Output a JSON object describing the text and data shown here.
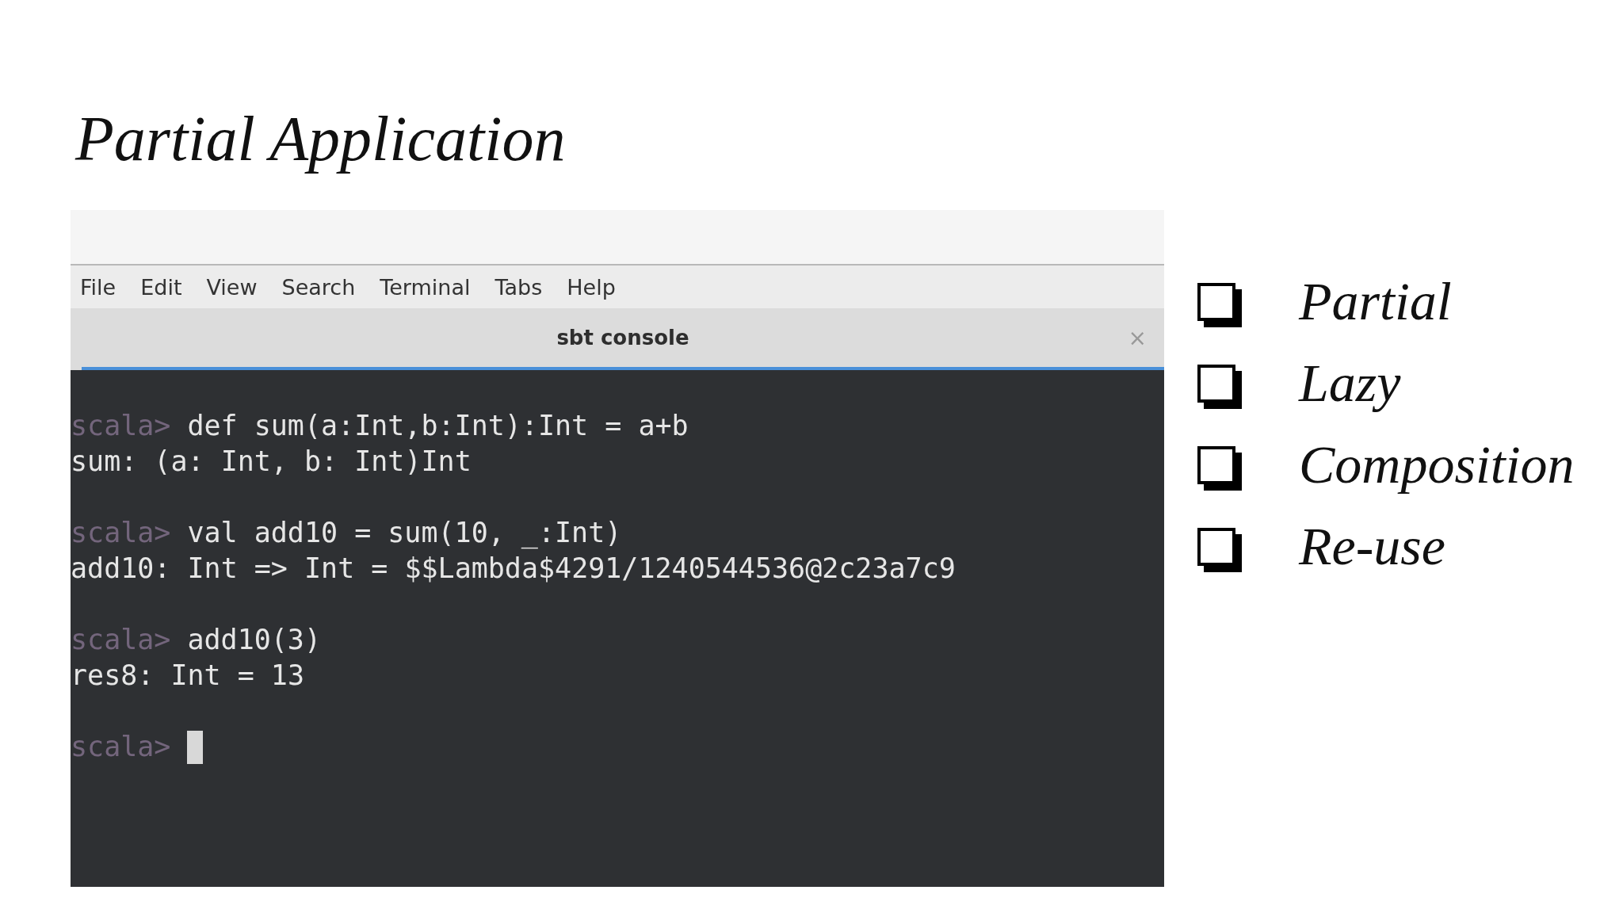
{
  "slide_title": "Partial Application",
  "terminal": {
    "menu": [
      "File",
      "Edit",
      "View",
      "Search",
      "Terminal",
      "Tabs",
      "Help"
    ],
    "tab": {
      "title": "sbt console",
      "close": "×"
    },
    "entries": [
      {
        "prompt": "scala>",
        "command": "def sum(a:Int,b:Int):Int = a+b",
        "output": "sum: (a: Int, b: Int)Int"
      },
      {
        "prompt": "scala>",
        "command": "val add10 = sum(10, _:Int)",
        "output": "add10: Int => Int = $$Lambda$4291/1240544536@2c23a7c9"
      },
      {
        "prompt": "scala>",
        "command": "add10(3)",
        "output": "res8: Int = 13"
      },
      {
        "prompt": "scala>",
        "cursor": true
      }
    ]
  },
  "bullets": [
    "Partial",
    "Lazy",
    "Composition",
    "Re-use"
  ]
}
